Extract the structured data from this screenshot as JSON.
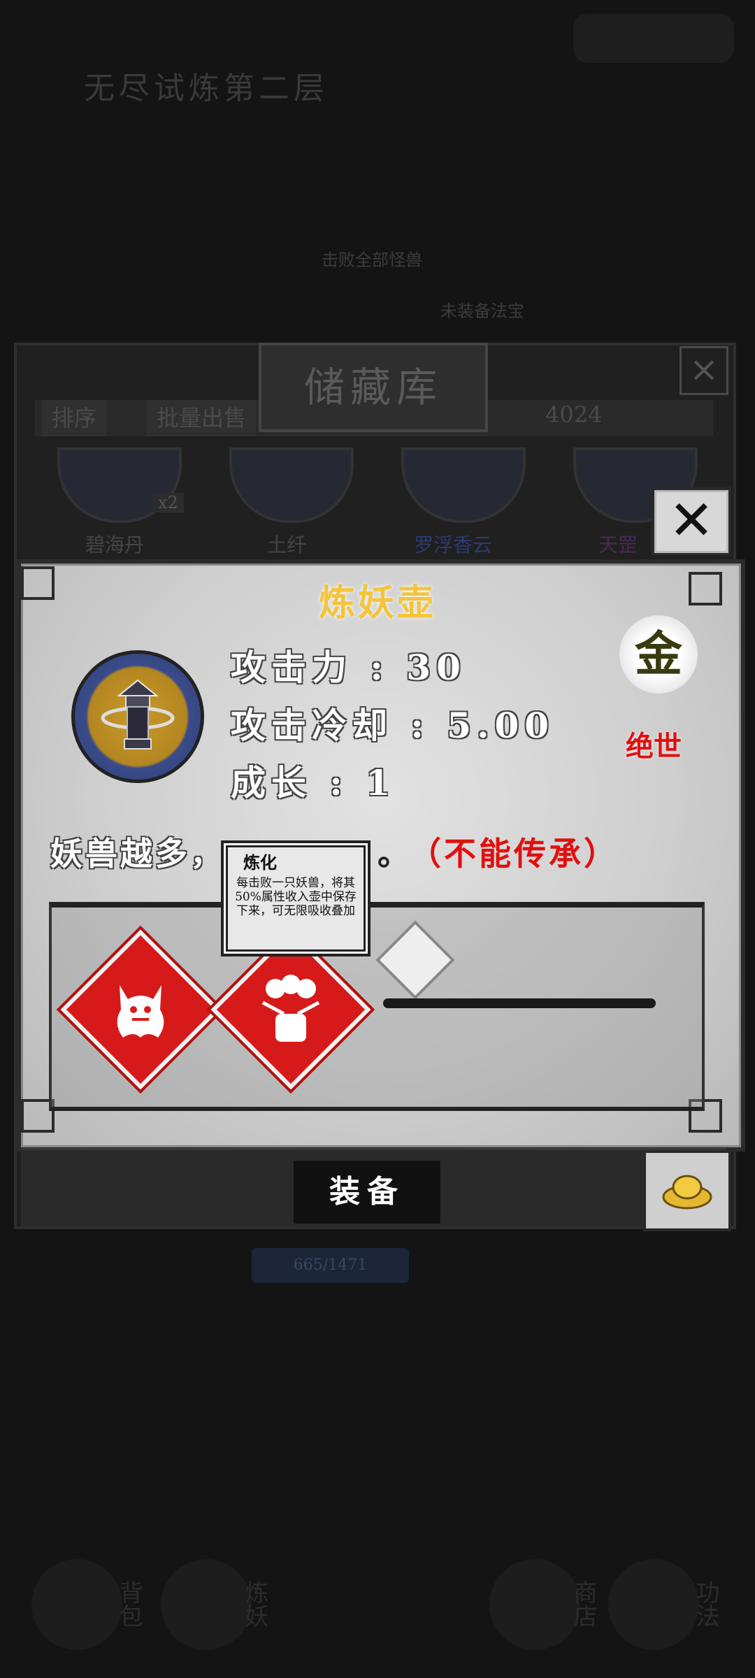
{
  "background": {
    "floor_title": "无尽试炼第二层",
    "text1": "击败全部怪兽",
    "text2": "未装备法宝",
    "bar_text": "665/1471",
    "bottom_nav": [
      "背包",
      "炼妖",
      "商店",
      "功法"
    ]
  },
  "storage": {
    "title": "储藏库",
    "sort_label": "排序",
    "batch_sell_label": "批量出售",
    "coin_count": "4024",
    "items": [
      {
        "name": "碧海丹",
        "count": "x2"
      },
      {
        "name": "土纤"
      },
      {
        "name": "罗浮香云"
      },
      {
        "name": "天罡"
      }
    ]
  },
  "detail": {
    "item_name": "炼妖壶",
    "stats": [
      {
        "label": "攻击力",
        "value": "30"
      },
      {
        "label": "攻击冷却",
        "value": "5.00"
      },
      {
        "label": "成长",
        "value": "1"
      }
    ],
    "grade_char": "金",
    "quality": "绝世",
    "desc_prefix": "妖兽越多，",
    "desc_suffix": "。",
    "desc_note": "（不能传承）",
    "tooltip": {
      "title": "炼化",
      "body": "每击败一只妖兽，将其50%属性收入壶中保存下来，可无限吸收叠加"
    },
    "equip_label": "装备"
  },
  "colors": {
    "title_gold": "#f4c43c",
    "quality_red": "#e01010",
    "skill_red": "#d61a1a"
  }
}
